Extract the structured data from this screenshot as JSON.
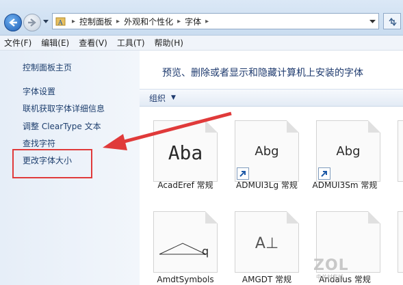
{
  "address_bar": {
    "crumbs": [
      "控制面板",
      "外观和个性化",
      "字体"
    ]
  },
  "menu": {
    "items": [
      "文件(F)",
      "编辑(E)",
      "查看(V)",
      "工具(T)",
      "帮助(H)"
    ]
  },
  "left_pane": {
    "home": "控制面板主页",
    "links": [
      "字体设置",
      "联机获取字体详细信息",
      "调整 ClearType 文本",
      "查找字符",
      "更改字体大小"
    ]
  },
  "right_pane": {
    "title": "预览、删除或者显示和隐藏计算机上安装的字体",
    "toolbar_organize": "组织",
    "fonts": [
      {
        "label": "AcadEref 常规",
        "glyph": "Aba",
        "shortcut": false
      },
      {
        "label": "ADMUI3Lg 常规",
        "glyph": "Abg",
        "shortcut": true
      },
      {
        "label": "ADMUI3Sm 常规",
        "glyph": "Abg",
        "shortcut": true
      },
      {
        "label": "AmdtSymbols",
        "glyph": "q",
        "shortcut": false
      },
      {
        "label": "AMGDT 常规",
        "glyph": "A⊥",
        "shortcut": false
      },
      {
        "label": "Andalus 常规",
        "glyph": "",
        "shortcut": false
      }
    ]
  },
  "watermark": {
    "text": "ZOL",
    "sub": "中关村在线"
  },
  "colors": {
    "highlight": "#e03a3a",
    "link": "#1e3f6e",
    "title": "#1e3a6e"
  }
}
